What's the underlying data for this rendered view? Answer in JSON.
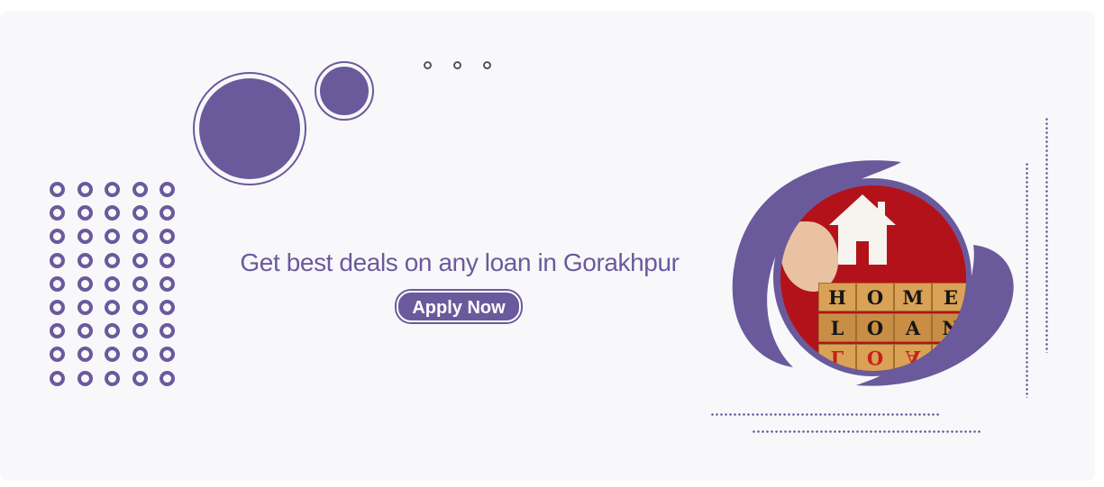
{
  "headline": "Get best deals on any loan in Gorakhpur",
  "cta": {
    "label": "Apply Now"
  },
  "photo": {
    "block_rows": [
      [
        "H",
        "O",
        "M",
        "E"
      ],
      [
        "L",
        "O",
        "A",
        "N"
      ],
      [
        "L",
        "O",
        "A",
        "N"
      ]
    ]
  },
  "colors": {
    "brand": "#6a5a9c",
    "background": "#f8f8fa",
    "photo_background": "#b3121a"
  },
  "icons": [
    "house-cutout-icon"
  ]
}
